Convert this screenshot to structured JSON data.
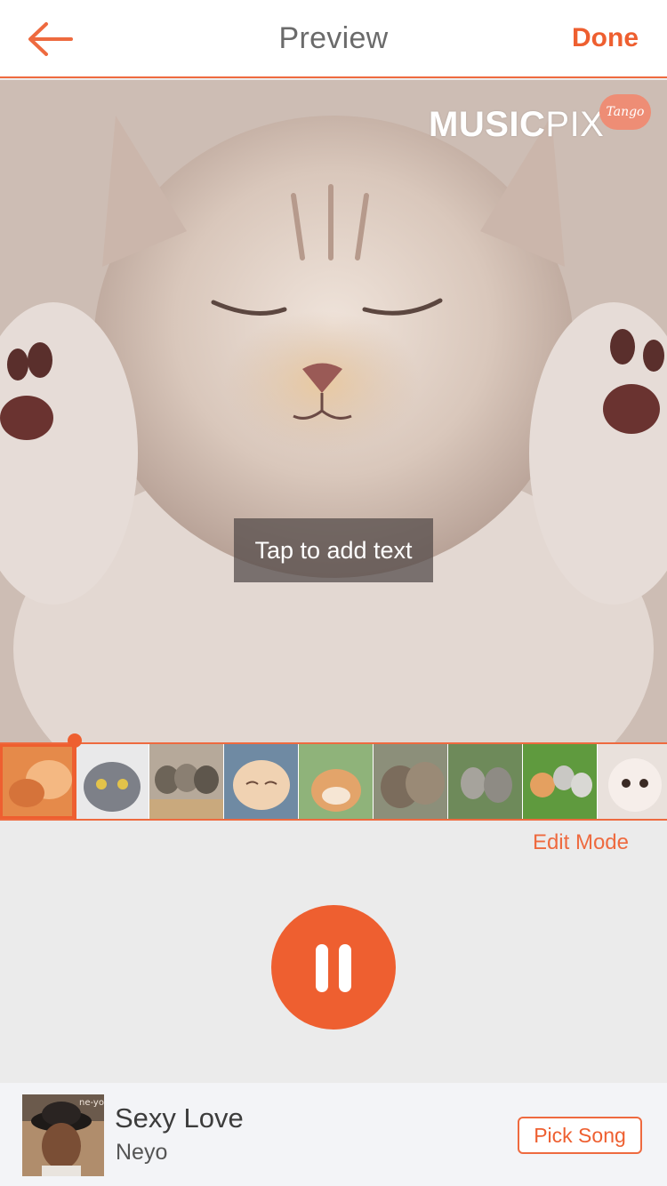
{
  "header": {
    "title": "Preview",
    "done_label": "Done",
    "back_icon": "arrow-left-icon"
  },
  "preview": {
    "watermark_brand_bold": "MUSIC",
    "watermark_brand_light": "PIX",
    "watermark_badge": "Tango",
    "tap_to_add_text": "Tap to add text"
  },
  "filmstrip": {
    "thumbnail_count": 9,
    "selected_index": 0
  },
  "edit_mode_label": "Edit Mode",
  "player": {
    "state_icon": "pause-icon"
  },
  "song": {
    "title": "Sexy Love",
    "artist": "Neyo",
    "album_art_text": "ne-yo",
    "pick_label": "Pick Song"
  },
  "colors": {
    "accent": "#ee5f30",
    "header_bg": "#ffffff",
    "body_bg": "#ebebeb",
    "songbar_bg": "#f3f4f7"
  }
}
